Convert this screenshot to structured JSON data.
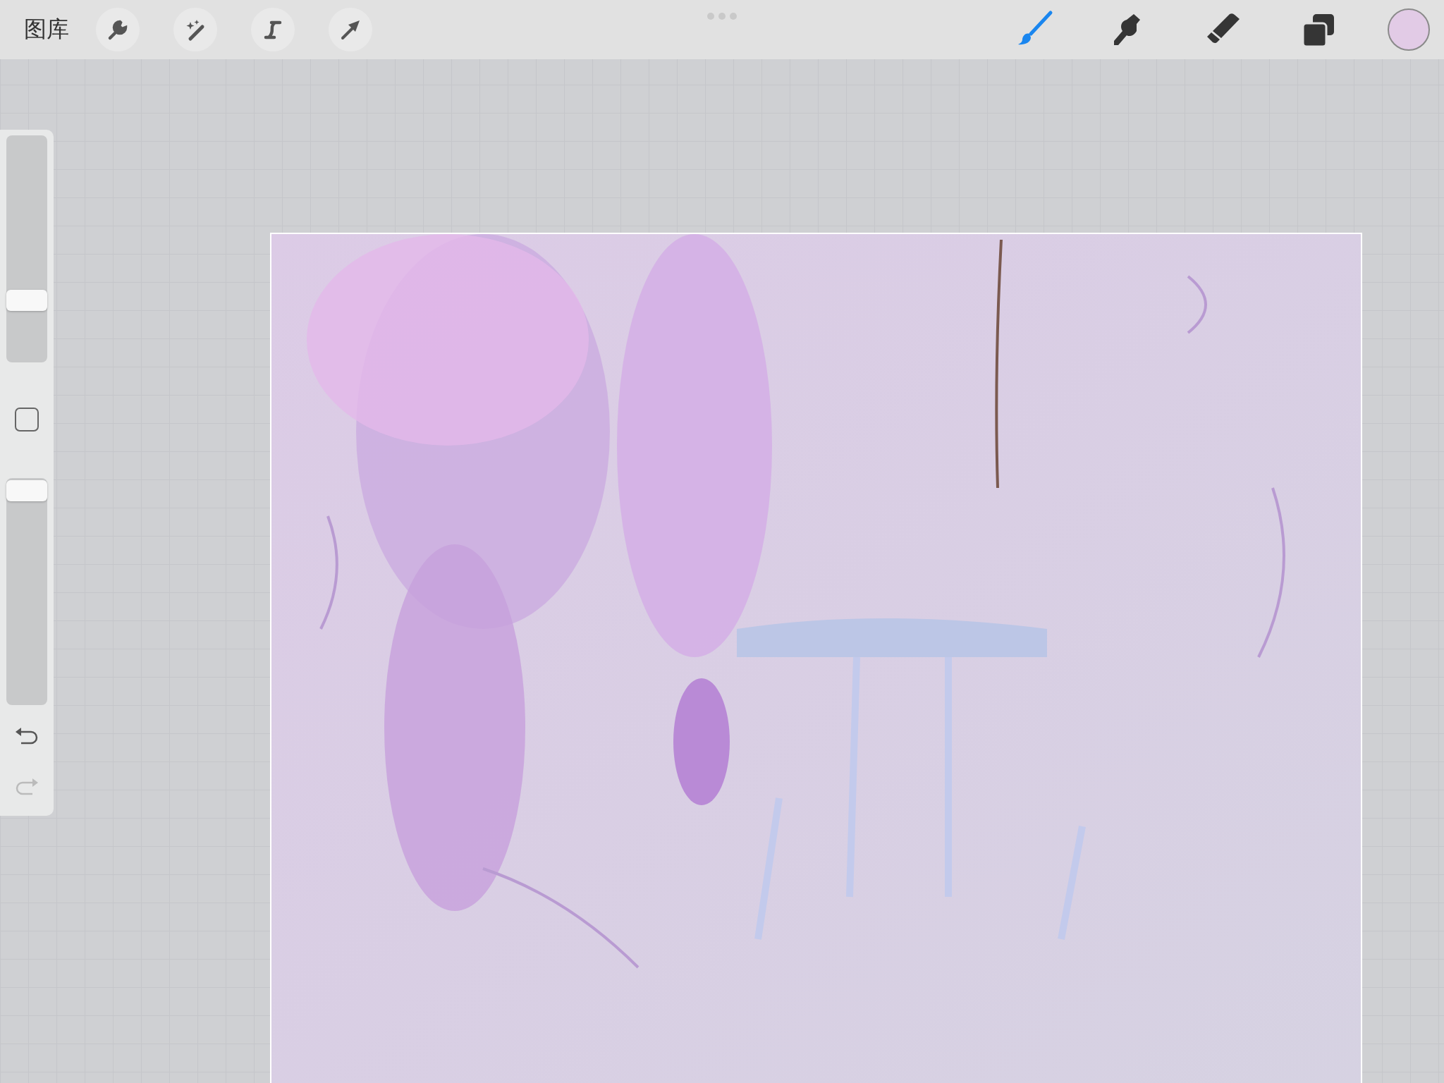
{
  "top_bar": {
    "gallery": "图库",
    "actions": [
      {
        "kind": "wrench"
      },
      {
        "kind": "wand"
      },
      {
        "kind": "select"
      },
      {
        "kind": "transform"
      }
    ],
    "tools": [
      {
        "kind": "brush",
        "selected": true
      },
      {
        "kind": "smudge",
        "selected": false
      },
      {
        "kind": "eraser",
        "selected": false
      },
      {
        "kind": "layers",
        "selected": false
      }
    ],
    "color": "#e2cbe6"
  },
  "sidebar": {
    "size_slider": {
      "level": 0.25
    },
    "opacity_slider": {
      "level": 0.99
    },
    "undo": {
      "disabled": false
    },
    "redo": {
      "disabled": true
    }
  }
}
